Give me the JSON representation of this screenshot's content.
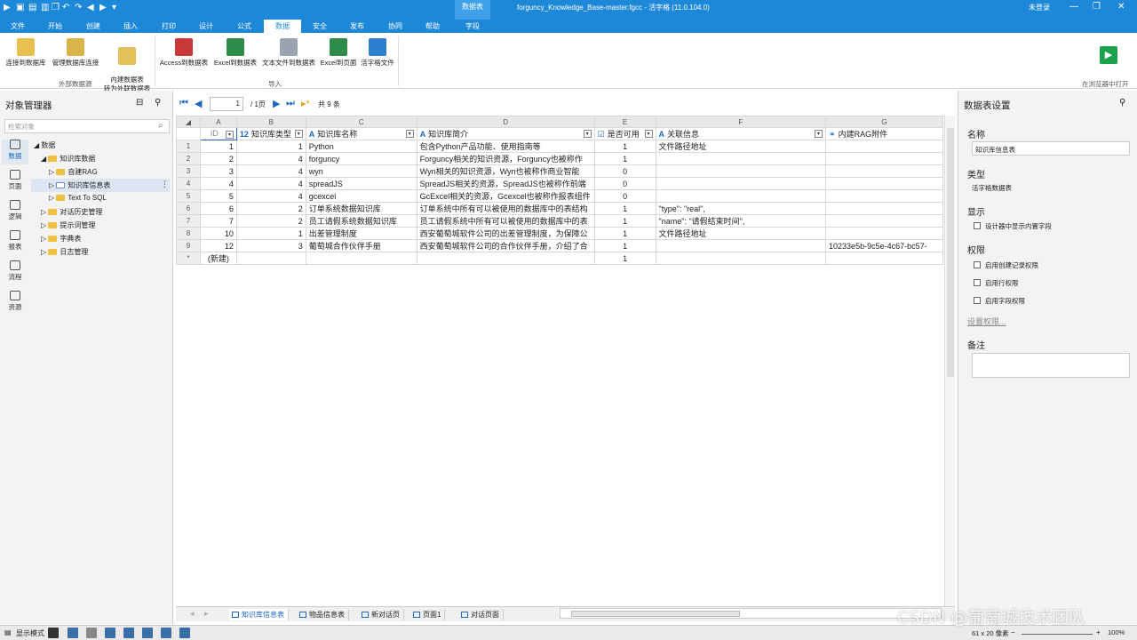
{
  "titlebar": {
    "context_tab": "数据表",
    "title": "forguncy_Knowledge_Base-master.fgcc - 活字格 (11.0.104.0)",
    "user": "未登录"
  },
  "tabs": [
    "文件",
    "开始",
    "创建",
    "插入",
    "打印",
    "设计",
    "公式",
    "数据",
    "安全",
    "发布",
    "协同",
    "帮助",
    "字段"
  ],
  "ribbon": {
    "external": [
      "连接到数据库",
      "管理数据库连接",
      "内建数据表\n转为外联数据表"
    ],
    "external_group": "外部数据源",
    "import": [
      "Access到数据表",
      "Excel到数据表",
      "文本文件到数据表",
      "Excel到页面",
      "活字格文件"
    ],
    "import_group": "导入",
    "open_browser": "在浏览器中打开"
  },
  "left": {
    "title": "对象管理器",
    "search_placeholder": "检索对象",
    "nav": [
      "数据",
      "页面",
      "逻辑",
      "报表",
      "流程",
      "资源"
    ],
    "tree": {
      "root": "数据",
      "kb": "知识库数据",
      "rag": "自建RAG",
      "table": "知识库信息表",
      "t2s": "Text To SQL",
      "hist": "对话历史管理",
      "prompt": "提示词管理",
      "dict": "字典表",
      "log": "日志管理"
    }
  },
  "pager": {
    "page": "1",
    "of": "/ 1页",
    "total": "共 9 条"
  },
  "grid": {
    "col_letters": [
      "A",
      "B",
      "C",
      "D",
      "E",
      "F",
      "G"
    ],
    "fields": [
      {
        "icon": "",
        "name": "ID"
      },
      {
        "icon": "12",
        "name": "知识库类型"
      },
      {
        "icon": "A",
        "name": "知识库名称"
      },
      {
        "icon": "A",
        "name": "知识库简介"
      },
      {
        "icon": "☑",
        "name": "是否可用"
      },
      {
        "icon": "A",
        "name": "关联信息"
      },
      {
        "icon": "⚭",
        "name": "内建RAG附件"
      }
    ],
    "rows": [
      [
        "1",
        "1",
        "1",
        "Python",
        "包含Python产品功能、使用指南等",
        "1",
        "文件路径地址",
        ""
      ],
      [
        "2",
        "2",
        "4",
        "forgunсy",
        "Forguncy相关的知识资源，Forguncy也被称作",
        "1",
        "",
        ""
      ],
      [
        "3",
        "3",
        "4",
        "wyn",
        "Wyn相关的知识资源，Wyn也被称作商业智能",
        "0",
        "",
        ""
      ],
      [
        "4",
        "4",
        "4",
        "spreadJS",
        "SpreadJS相关的资源，SpreadJS也被称作前端",
        "0",
        "",
        ""
      ],
      [
        "5",
        "5",
        "4",
        "gcexcel",
        "GcExcel相关的资源，Gcexcel也被称作报表组件",
        "0",
        "",
        ""
      ],
      [
        "6",
        "6",
        "2",
        "订单系统数据知识库",
        "订单系统中所有可以被使用的数据库中的表结构",
        "1",
        "        \"type\": \"real\",",
        ""
      ],
      [
        "7",
        "7",
        "2",
        "员工请假系统数据知识库",
        "员工请假系统中所有可以被使用的数据库中的表",
        "1",
        "        \"name\": \"请假结束时间\",",
        ""
      ],
      [
        "8",
        "10",
        "1",
        "出差管理制度",
        "西安葡萄城软件公司的出差管理制度，为保障公",
        "1",
        "文件路径地址",
        ""
      ],
      [
        "9",
        "12",
        "3",
        "葡萄城合作伙伴手册",
        "西安葡萄城软件公司的合作伙伴手册，介绍了合",
        "1",
        "",
        "10233e5b-9c5e-4c67-bc57-"
      ]
    ],
    "new_row": [
      "*",
      "(新建)",
      "",
      "",
      "",
      "1",
      "",
      ""
    ]
  },
  "sheet_tabs": [
    "知识库信息表",
    "物品信息表",
    "新对话页",
    "页面1",
    "对话页面"
  ],
  "right": {
    "title": "数据表设置",
    "name_label": "名称",
    "name_value": "知识库信息表",
    "type_label": "类型",
    "type_value": "活字格数据表",
    "display_label": "显示",
    "display_opt": "设计器中显示内置字段",
    "perm_label": "权限",
    "perm_opts": [
      "启用创建记录权限",
      "启用行权限",
      "启用字段权限"
    ],
    "perm_link": "设置权限...",
    "notes_label": "备注"
  },
  "status": {
    "mode": "显示模式",
    "size": "61 x 20 像素",
    "zoom": "100%"
  },
  "watermark": "CSDN @葡萄城技术团队"
}
